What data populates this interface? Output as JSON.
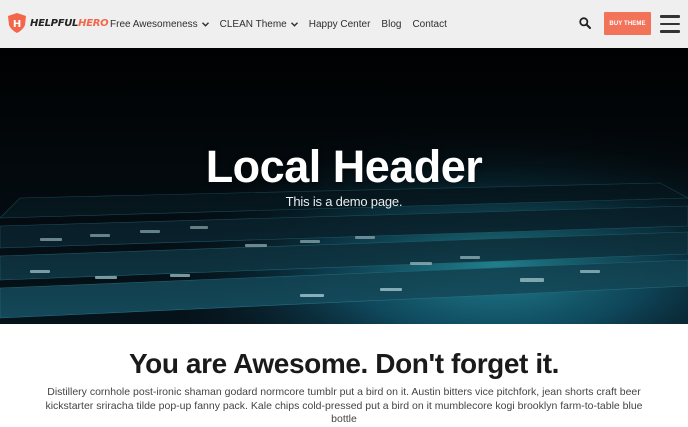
{
  "header": {
    "logo": {
      "text_part1": "HELPFUL",
      "text_part2": "HERO",
      "icon": "hero-shield-icon",
      "letter": "H"
    },
    "nav": [
      {
        "label": "Free Awesomeness",
        "has_dropdown": true
      },
      {
        "label": "CLEAN Theme",
        "has_dropdown": true
      },
      {
        "label": "Happy Center",
        "has_dropdown": false
      },
      {
        "label": "Blog",
        "has_dropdown": false
      },
      {
        "label": "Contact",
        "has_dropdown": false
      }
    ],
    "search_icon": "search-icon",
    "buy_label": "BUY THEME",
    "menu_icon": "hamburger-menu-icon"
  },
  "hero": {
    "title": "Local Header",
    "subtitle": "This is a demo page."
  },
  "content": {
    "title": "You are Awesome. Don't forget it.",
    "body": "Distillery cornhole post-ironic shaman godard normcore tumblr put a bird on it. Austin bitters vice pitchfork, jean shorts craft beer kickstarter sriracha tilde pop-up fanny pack. Kale chips cold-pressed put a bird on it mumblecore kogi brooklyn farm-to-table blue bottle"
  },
  "colors": {
    "accent": "#f2735a",
    "logo_accent": "#f26649",
    "header_bg": "#efefef",
    "hero_dark": "#04060a",
    "hero_teal": "#1b8fa3"
  }
}
